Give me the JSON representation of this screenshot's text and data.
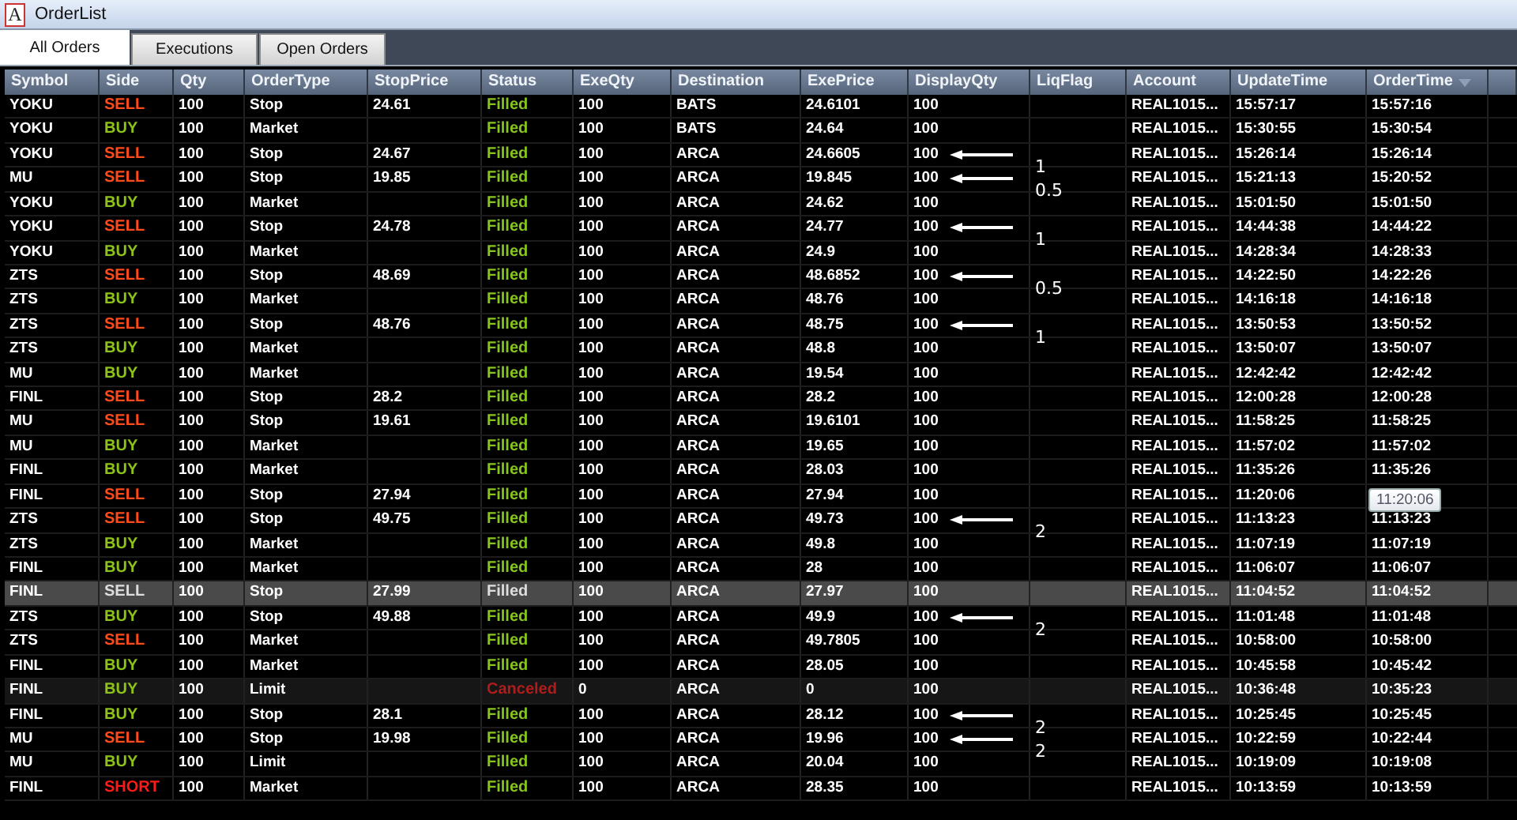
{
  "window": {
    "icon_letter": "A",
    "title": "OrderList"
  },
  "tabs": [
    {
      "label": "All Orders",
      "selected": true
    },
    {
      "label": "Executions",
      "selected": false
    },
    {
      "label": "Open Orders",
      "selected": false
    }
  ],
  "table": {
    "columns": [
      {
        "label": "Symbol",
        "sorted": false
      },
      {
        "label": "Side",
        "sorted": false
      },
      {
        "label": "Qty",
        "sorted": false
      },
      {
        "label": "OrderType",
        "sorted": false
      },
      {
        "label": "StopPrice",
        "sorted": false
      },
      {
        "label": "Status",
        "sorted": false
      },
      {
        "label": "ExeQty",
        "sorted": false
      },
      {
        "label": "Destination",
        "sorted": false
      },
      {
        "label": "ExePrice",
        "sorted": false
      },
      {
        "label": "DisplayQty",
        "sorted": false
      },
      {
        "label": "LiqFlag",
        "sorted": false
      },
      {
        "label": "Account",
        "sorted": false
      },
      {
        "label": "UpdateTime",
        "sorted": false
      },
      {
        "label": "OrderTime",
        "sorted": true
      }
    ],
    "rows": [
      {
        "selected": false,
        "dimmed": false,
        "cells": [
          "YOKU",
          {
            "text": "SELL",
            "kind": "sell"
          },
          "100",
          "Stop",
          "24.61",
          {
            "text": "Filled",
            "kind": "filled"
          },
          "100",
          "BATS",
          "24.6101",
          "100",
          "",
          "REAL1015...",
          "15:57:17",
          "15:57:16"
        ]
      },
      {
        "selected": false,
        "dimmed": false,
        "cells": [
          "YOKU",
          {
            "text": "BUY",
            "kind": "buy"
          },
          "100",
          "Market",
          "",
          {
            "text": "Filled",
            "kind": "filled"
          },
          "100",
          "BATS",
          "24.64",
          "100",
          "",
          "REAL1015...",
          "15:30:55",
          "15:30:54"
        ]
      },
      {
        "selected": false,
        "dimmed": false,
        "note": "1",
        "cells": [
          "YOKU",
          {
            "text": "SELL",
            "kind": "sell"
          },
          "100",
          "Stop",
          "24.67",
          {
            "text": "Filled",
            "kind": "filled"
          },
          "100",
          "ARCA",
          "24.6605",
          "100",
          "",
          "REAL1015...",
          "15:26:14",
          "15:26:14"
        ]
      },
      {
        "selected": false,
        "dimmed": false,
        "note": "0.5",
        "cells": [
          "MU",
          {
            "text": "SELL",
            "kind": "sell"
          },
          "100",
          "Stop",
          "19.85",
          {
            "text": "Filled",
            "kind": "filled"
          },
          "100",
          "ARCA",
          "19.845",
          "100",
          "",
          "REAL1015...",
          "15:21:13",
          "15:20:52"
        ]
      },
      {
        "selected": false,
        "dimmed": false,
        "cells": [
          "YOKU",
          {
            "text": "BUY",
            "kind": "buy"
          },
          "100",
          "Market",
          "",
          {
            "text": "Filled",
            "kind": "filled"
          },
          "100",
          "ARCA",
          "24.62",
          "100",
          "",
          "REAL1015...",
          "15:01:50",
          "15:01:50"
        ]
      },
      {
        "selected": false,
        "dimmed": false,
        "note": "1",
        "cells": [
          "YOKU",
          {
            "text": "SELL",
            "kind": "sell"
          },
          "100",
          "Stop",
          "24.78",
          {
            "text": "Filled",
            "kind": "filled"
          },
          "100",
          "ARCA",
          "24.77",
          "100",
          "",
          "REAL1015...",
          "14:44:38",
          "14:44:22"
        ]
      },
      {
        "selected": false,
        "dimmed": false,
        "cells": [
          "YOKU",
          {
            "text": "BUY",
            "kind": "buy"
          },
          "100",
          "Market",
          "",
          {
            "text": "Filled",
            "kind": "filled"
          },
          "100",
          "ARCA",
          "24.9",
          "100",
          "",
          "REAL1015...",
          "14:28:34",
          "14:28:33"
        ]
      },
      {
        "selected": false,
        "dimmed": false,
        "note": "0.5",
        "cells": [
          "ZTS",
          {
            "text": "SELL",
            "kind": "sell"
          },
          "100",
          "Stop",
          "48.69",
          {
            "text": "Filled",
            "kind": "filled"
          },
          "100",
          "ARCA",
          "48.6852",
          "100",
          "",
          "REAL1015...",
          "14:22:50",
          "14:22:26"
        ]
      },
      {
        "selected": false,
        "dimmed": false,
        "cells": [
          "ZTS",
          {
            "text": "BUY",
            "kind": "buy"
          },
          "100",
          "Market",
          "",
          {
            "text": "Filled",
            "kind": "filled"
          },
          "100",
          "ARCA",
          "48.76",
          "100",
          "",
          "REAL1015...",
          "14:16:18",
          "14:16:18"
        ]
      },
      {
        "selected": false,
        "dimmed": false,
        "note": "1",
        "cells": [
          "ZTS",
          {
            "text": "SELL",
            "kind": "sell"
          },
          "100",
          "Stop",
          "48.76",
          {
            "text": "Filled",
            "kind": "filled"
          },
          "100",
          "ARCA",
          "48.75",
          "100",
          "",
          "REAL1015...",
          "13:50:53",
          "13:50:52"
        ]
      },
      {
        "selected": false,
        "dimmed": false,
        "cells": [
          "ZTS",
          {
            "text": "BUY",
            "kind": "buy"
          },
          "100",
          "Market",
          "",
          {
            "text": "Filled",
            "kind": "filled"
          },
          "100",
          "ARCA",
          "48.8",
          "100",
          "",
          "REAL1015...",
          "13:50:07",
          "13:50:07"
        ]
      },
      {
        "selected": false,
        "dimmed": false,
        "cells": [
          "MU",
          {
            "text": "BUY",
            "kind": "buy"
          },
          "100",
          "Market",
          "",
          {
            "text": "Filled",
            "kind": "filled"
          },
          "100",
          "ARCA",
          "19.54",
          "100",
          "",
          "REAL1015...",
          "12:42:42",
          "12:42:42"
        ]
      },
      {
        "selected": false,
        "dimmed": false,
        "cells": [
          "FINL",
          {
            "text": "SELL",
            "kind": "sell"
          },
          "100",
          "Stop",
          "28.2",
          {
            "text": "Filled",
            "kind": "filled"
          },
          "100",
          "ARCA",
          "28.2",
          "100",
          "",
          "REAL1015...",
          "12:00:28",
          "12:00:28"
        ]
      },
      {
        "selected": false,
        "dimmed": false,
        "cells": [
          "MU",
          {
            "text": "SELL",
            "kind": "sell"
          },
          "100",
          "Stop",
          "19.61",
          {
            "text": "Filled",
            "kind": "filled"
          },
          "100",
          "ARCA",
          "19.6101",
          "100",
          "",
          "REAL1015...",
          "11:58:25",
          "11:58:25"
        ]
      },
      {
        "selected": false,
        "dimmed": false,
        "cells": [
          "MU",
          {
            "text": "BUY",
            "kind": "buy"
          },
          "100",
          "Market",
          "",
          {
            "text": "Filled",
            "kind": "filled"
          },
          "100",
          "ARCA",
          "19.65",
          "100",
          "",
          "REAL1015...",
          "11:57:02",
          "11:57:02"
        ]
      },
      {
        "selected": false,
        "dimmed": false,
        "cells": [
          "FINL",
          {
            "text": "BUY",
            "kind": "buy"
          },
          "100",
          "Market",
          "",
          {
            "text": "Filled",
            "kind": "filled"
          },
          "100",
          "ARCA",
          "28.03",
          "100",
          "",
          "REAL1015...",
          "11:35:26",
          "11:35:26"
        ]
      },
      {
        "selected": false,
        "dimmed": false,
        "cells": [
          "FINL",
          {
            "text": "SELL",
            "kind": "sell"
          },
          "100",
          "Stop",
          "27.94",
          {
            "text": "Filled",
            "kind": "filled"
          },
          "100",
          "ARCA",
          "27.94",
          "100",
          "",
          "REAL1015...",
          "11:20:06",
          ""
        ]
      },
      {
        "selected": false,
        "dimmed": false,
        "note": "2",
        "cells": [
          "ZTS",
          {
            "text": "SELL",
            "kind": "sell"
          },
          "100",
          "Stop",
          "49.75",
          {
            "text": "Filled",
            "kind": "filled"
          },
          "100",
          "ARCA",
          "49.73",
          "100",
          "",
          "REAL1015...",
          "11:13:23",
          "11:13:23"
        ]
      },
      {
        "selected": false,
        "dimmed": false,
        "cells": [
          "ZTS",
          {
            "text": "BUY",
            "kind": "buy"
          },
          "100",
          "Market",
          "",
          {
            "text": "Filled",
            "kind": "filled"
          },
          "100",
          "ARCA",
          "49.8",
          "100",
          "",
          "REAL1015...",
          "11:07:19",
          "11:07:19"
        ]
      },
      {
        "selected": false,
        "dimmed": false,
        "cells": [
          "FINL",
          {
            "text": "BUY",
            "kind": "buy"
          },
          "100",
          "Market",
          "",
          {
            "text": "Filled",
            "kind": "filled"
          },
          "100",
          "ARCA",
          "28",
          "100",
          "",
          "REAL1015...",
          "11:06:07",
          "11:06:07"
        ]
      },
      {
        "selected": true,
        "dimmed": false,
        "cells": [
          "FINL",
          {
            "text": "SELL",
            "kind": "sell"
          },
          "100",
          "Stop",
          "27.99",
          {
            "text": "Filled",
            "kind": "filled"
          },
          "100",
          "ARCA",
          "27.97",
          "100",
          "",
          "REAL1015...",
          "11:04:52",
          "11:04:52"
        ]
      },
      {
        "selected": false,
        "dimmed": false,
        "note": "2",
        "cells": [
          "ZTS",
          {
            "text": "BUY",
            "kind": "buy"
          },
          "100",
          "Stop",
          "49.88",
          {
            "text": "Filled",
            "kind": "filled"
          },
          "100",
          "ARCA",
          "49.9",
          "100",
          "",
          "REAL1015...",
          "11:01:48",
          "11:01:48"
        ]
      },
      {
        "selected": false,
        "dimmed": false,
        "cells": [
          "ZTS",
          {
            "text": "SELL",
            "kind": "sell"
          },
          "100",
          "Market",
          "",
          {
            "text": "Filled",
            "kind": "filled"
          },
          "100",
          "ARCA",
          "49.7805",
          "100",
          "",
          "REAL1015...",
          "10:58:00",
          "10:58:00"
        ]
      },
      {
        "selected": false,
        "dimmed": false,
        "cells": [
          "FINL",
          {
            "text": "BUY",
            "kind": "buy"
          },
          "100",
          "Market",
          "",
          {
            "text": "Filled",
            "kind": "filled"
          },
          "100",
          "ARCA",
          "28.05",
          "100",
          "",
          "REAL1015...",
          "10:45:58",
          "10:45:42"
        ]
      },
      {
        "selected": false,
        "dimmed": true,
        "cells": [
          "FINL",
          {
            "text": "BUY",
            "kind": "buy"
          },
          "100",
          "Limit",
          "",
          {
            "text": "Canceled",
            "kind": "canceled"
          },
          "0",
          "ARCA",
          "0",
          "100",
          "",
          "REAL1015...",
          "10:36:48",
          "10:35:23"
        ]
      },
      {
        "selected": false,
        "dimmed": false,
        "note": "2",
        "cells": [
          "FINL",
          {
            "text": "BUY",
            "kind": "buy"
          },
          "100",
          "Stop",
          "28.1",
          {
            "text": "Filled",
            "kind": "filled"
          },
          "100",
          "ARCA",
          "28.12",
          "100",
          "",
          "REAL1015...",
          "10:25:45",
          "10:25:45"
        ]
      },
      {
        "selected": false,
        "dimmed": false,
        "note": "2",
        "cells": [
          "MU",
          {
            "text": "SELL",
            "kind": "sell"
          },
          "100",
          "Stop",
          "19.98",
          {
            "text": "Filled",
            "kind": "filled"
          },
          "100",
          "ARCA",
          "19.96",
          "100",
          "",
          "REAL1015...",
          "10:22:59",
          "10:22:44"
        ]
      },
      {
        "selected": false,
        "dimmed": false,
        "cells": [
          "MU",
          {
            "text": "BUY",
            "kind": "buy"
          },
          "100",
          "Limit",
          "",
          {
            "text": "Filled",
            "kind": "filled"
          },
          "100",
          "ARCA",
          "20.04",
          "100",
          "",
          "REAL1015...",
          "10:19:09",
          "10:19:08"
        ]
      },
      {
        "selected": false,
        "dimmed": false,
        "cells": [
          "FINL",
          {
            "text": "SHORT",
            "kind": "short"
          },
          "100",
          "Market",
          "",
          {
            "text": "Filled",
            "kind": "filled"
          },
          "100",
          "ARCA",
          "28.35",
          "100",
          "",
          "REAL1015...",
          "10:13:59",
          "10:13:59"
        ]
      }
    ]
  },
  "tooltip": {
    "text": "11:20:06"
  }
}
